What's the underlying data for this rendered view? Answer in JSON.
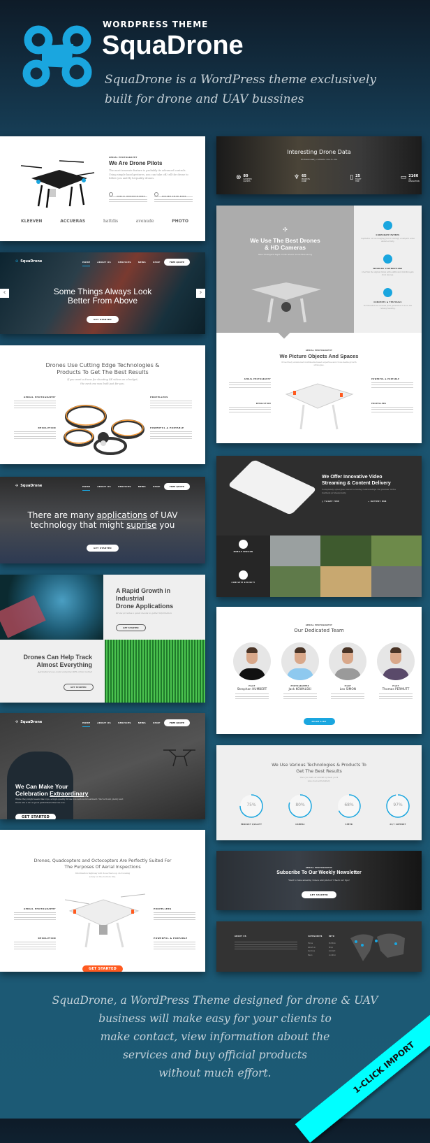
{
  "header": {
    "eyebrow": "WORDPRESS THEME",
    "title": "SquaDrone",
    "tagline_1": "SquaDrone is a WordPress theme exclusively",
    "tagline_2": "built for drone and UAV bussines",
    "brand_color": "#1aa6df"
  },
  "nav": {
    "logo": "SquaDrone",
    "items": [
      "HOME",
      "ABOUT US",
      "SERVICES",
      "NEWS",
      "SHOP",
      "CONTACT"
    ],
    "quote": "FREE QUOTE"
  },
  "pilots": {
    "eyebrow": "AERIAL PHOTOGRAPHY",
    "title": "We Are Drone Pilots",
    "text": "The most innovate feature is probably its advanced controls. Using simple hand gestures, you can take off, tell the drone to follow you and fly hi-quality drones.",
    "f1": "AERIAL PHOTOGRAPHY",
    "f2": "FASTER THAN EVER",
    "logos": [
      "KLEEVEN",
      "ACCUERAS",
      "hattdis",
      "avenude",
      "PHOTO"
    ]
  },
  "slider": {
    "title_1": "Some Things Always Look",
    "title_2": "Better From Above",
    "button": "GET STARTED",
    "prev": "‹",
    "next": "›"
  },
  "tech": {
    "title_1": "Drones Use Cutting Edge Technologies &",
    "title_2": "Products To Get The Best Results",
    "sub_1": "If you want a drone for shooting 4K videos on a budget,",
    "sub_2": "the next one was built just for you.",
    "f": [
      "AERIAL PHOTOGRAPHY",
      "RESOLUTION",
      "PROPELLERS",
      "POWERFUL & PORTABLE"
    ]
  },
  "applications": {
    "t1": "There are many ",
    "u1": "applications",
    "t2": " of UAV",
    "t3": "technology that might ",
    "u2": "suprise",
    "t4": " you",
    "button": "GET STARTED"
  },
  "growth": {
    "title_1": "A Rapid Growth in",
    "title_2": "Industrial",
    "title_3": "Drone Applications",
    "sub": "Drone provides a quick means to gather information",
    "button": "GET STARTED"
  },
  "track": {
    "title_1": "Drones Can Help Track",
    "title_2": "Almost Everything",
    "sub": "Agricultural use could comprise 80% of the market",
    "button": "GET STARTED"
  },
  "celebration": {
    "title_1": "We Can Make Your",
    "title_2a": "Celebration ",
    "title_2b": "Extraordinary",
    "text": "While they might seem like toys, a high-quality drone is a serious investment. We've flown plenty and there are a lot of good performers that we use.",
    "button": "GET STARTED"
  },
  "quad": {
    "title_1": "Drones, Quadcopters and Octocopters Are Perfectly Suited For",
    "title_2": "The Purposes Of Aerial Inspections",
    "sub_1": "Information highway will close the loop on focusing",
    "sub_2": "solely on the bottom line.",
    "f": [
      "AERIAL PHOTOGRAPHY",
      "RESOLUTION",
      "PROPELLERS",
      "POWERFUL & PORTABLE"
    ],
    "button": "GET STARTED",
    "accent": "#ff5a1f"
  },
  "data": {
    "title": "Interesting Drone Data",
    "sub": "Professionally cultivate one-to-one",
    "stats": [
      {
        "value": "80",
        "label": "SATISFIED CLIENTS"
      },
      {
        "value": "65",
        "label": "PROJECTS DONE"
      },
      {
        "value": "25",
        "label": "FLIGHT TIME"
      },
      {
        "value": "2160",
        "label": "4K RESOLUTION"
      }
    ]
  },
  "best": {
    "title_1": "We Use The Best Drones",
    "title_2": "& HD Cameras",
    "sub": "New intelligent flight mode where drone flies along",
    "services": [
      {
        "title": "CORPORATE EVENTS",
        "text": "Capitalize on low hanging fruit to identify a ballpark value added activity."
      },
      {
        "title": "WEDDING CELEBRATIONS",
        "text": "Override the digital divide with additional clickthroughs from devops."
      },
      {
        "title": "CONCERTS & FESTIVALS",
        "text": "Normal that has evolved from generation X is on the runway heading."
      }
    ]
  },
  "picture": {
    "eyebrow": "AERIAL PHOTOGRAPHY",
    "title": "We Picture Objects And Spaces",
    "sub": "Proactively envisioned multimedia based expertise and cross-media growth strategies.",
    "f": [
      "AERIAL PHOTOGRAPHY",
      "RESOLUTION",
      "POWERFUL & PORTABLE",
      "PROPELLERS"
    ]
  },
  "video": {
    "title_1": "We Offer Innovative Video",
    "title_2": "Streaming & Content Delivery",
    "sub": "Completely synergize resource taxing relationships via premier niche markets professionally.",
    "f1": "FLIGHT TIME",
    "f2": "BATTERY HUB",
    "side": [
      "MOBILE VERSION",
      "COMPLETE SECURITY"
    ]
  },
  "team": {
    "eyebrow": "AERIAL PHOTOGRAPHY",
    "title": "Our Dedicated Team",
    "members": [
      {
        "role": "PILOT",
        "name": "Stesphan HUMBERT",
        "shirt": "#111111"
      },
      {
        "role": "PHOTOGRAPHER",
        "name": "Jack KOWALSKI",
        "shirt": "#8ec9ef"
      },
      {
        "role": "PILOT",
        "name": "Leo SIMON",
        "shirt": "#9a9a9a"
      },
      {
        "role": "PILOT",
        "name": "Thomas PERMUTT",
        "shirt": "#5a4a6a"
      }
    ],
    "button": "PILOT LIST"
  },
  "skills": {
    "title_1": "We Use Various Technologies & Products To",
    "title_2": "Get The Best Results",
    "sub_1": "Once you rent our aircraft by itself, you'll",
    "sub_2": "save on an extra battery.",
    "items": [
      {
        "value": 75,
        "label": "PRODUCT QUALITY"
      },
      {
        "value": 80,
        "label": "CAMERA"
      },
      {
        "value": 68,
        "label": "SPEED"
      },
      {
        "value": 97,
        "label": "24/7 SUPPORT"
      }
    ]
  },
  "newsletter": {
    "eyebrow": "AERIAL PHOTOGRAPHY",
    "title": "Subscribe To Our Weekly Newsletter",
    "sub": "Want to take amazing videos and photos? Check our tips!",
    "button": "GET STARTED"
  },
  "footer": {
    "about": "ABOUT US",
    "categories": "CATEGORIES",
    "info": "INFO",
    "cat_links": [
      "Home",
      "About us",
      "Services",
      "News"
    ],
    "info_links": [
      "Portfolio",
      "Shop",
      "Contact",
      "Location"
    ]
  },
  "bottom": {
    "lines": [
      "SquaDrone, a WordPress Theme designed for drone & UAV",
      "business will make easy for your clients to",
      "make contact, view information about the",
      "services and buy official products",
      "without much effort."
    ],
    "ribbon": "1-CLICK IMPORT",
    "ribbon_color": "#00ffff"
  }
}
